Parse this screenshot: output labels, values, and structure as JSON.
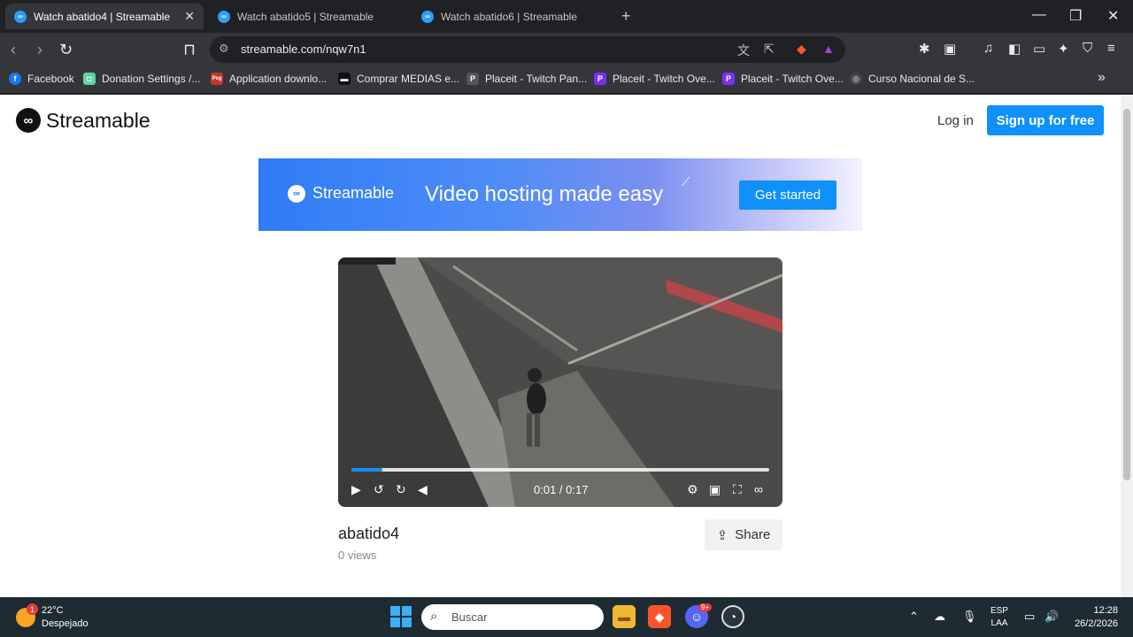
{
  "tabs": [
    {
      "title": "Watch abatido4 | Streamable",
      "active": true,
      "close": "✕"
    },
    {
      "title": "Watch abatido5 | Streamable",
      "active": false
    },
    {
      "title": "Watch abatido6 | Streamable",
      "active": false
    }
  ],
  "new_tab": "+",
  "address": {
    "url": "streamable.com/nqw7n1"
  },
  "bookmarks": [
    {
      "label": "Facebook",
      "icon": "facebook-icon",
      "color": "#1877f2",
      "glyph": "f"
    },
    {
      "label": "Donation Settings /...",
      "icon": "streamelements-icon",
      "color": "#5ed3a4",
      "glyph": "◘"
    },
    {
      "label": "Application downlo...",
      "icon": "peg-icon",
      "color": "#c0392b",
      "glyph": "Peg"
    },
    {
      "label": "Comprar MEDIAS e...",
      "icon": "store-icon",
      "color": "#111111",
      "glyph": "▬"
    },
    {
      "label": "Placeit - Twitch Pan...",
      "icon": "placeit-icon",
      "color": "#555555",
      "glyph": "P"
    },
    {
      "label": "Placeit - Twitch Ove...",
      "icon": "placeit-icon",
      "color": "#7b2ff7",
      "glyph": "P"
    },
    {
      "label": "Placeit - Twitch Ove...",
      "icon": "placeit-icon",
      "color": "#7b2ff7",
      "glyph": "P"
    },
    {
      "label": "Curso Nacional de S...",
      "icon": "course-icon",
      "color": "#444444",
      "glyph": "◎"
    }
  ],
  "bookmarks_more": "»",
  "site": {
    "brand": "Streamable",
    "login": "Log in",
    "signup": "Sign up for free"
  },
  "banner": {
    "brand": "Streamable",
    "tagline": "Video hosting made easy",
    "cta": "Get started"
  },
  "video": {
    "time": "0:01 / 0:17",
    "progress": 0.075,
    "title": "abatido4",
    "views": "0 views",
    "share": "Share"
  },
  "taskbar": {
    "weather_temp": "22°C",
    "weather_desc": "Despejado",
    "weather_badge": "1",
    "search_placeholder": "Buscar",
    "lang_line1": "ESP",
    "lang_line2": "LAA",
    "time": "12:28",
    "date": "26/2/2026",
    "discord_badge": "9+"
  },
  "colors": {
    "accent": "#0f90fa",
    "tab_active": "#35363a",
    "taskbar": "#1f2b33"
  }
}
